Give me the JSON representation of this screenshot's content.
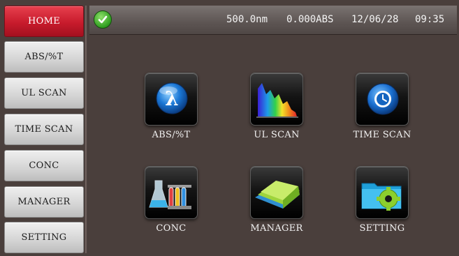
{
  "sidebar": {
    "items": [
      {
        "label": "HOME",
        "active": true
      },
      {
        "label": "ABS/%T",
        "active": false
      },
      {
        "label": "UL SCAN",
        "active": false
      },
      {
        "label": "TIME SCAN",
        "active": false
      },
      {
        "label": "CONC",
        "active": false
      },
      {
        "label": "MANAGER",
        "active": false
      },
      {
        "label": "SETTING",
        "active": false
      }
    ]
  },
  "status": {
    "icon": "check-circle-icon",
    "wavelength": "500.0nm",
    "absorbance": "0.000ABS",
    "date": "12/06/28",
    "time": "09:35"
  },
  "tiles": [
    {
      "label": "ABS/%T",
      "icon": "lambda-icon"
    },
    {
      "label": "UL SCAN",
      "icon": "spectrum-icon"
    },
    {
      "label": "TIME SCAN",
      "icon": "clock-icon"
    },
    {
      "label": "CONC",
      "icon": "flasks-icon"
    },
    {
      "label": "MANAGER",
      "icon": "folders-icon"
    },
    {
      "label": "SETTING",
      "icon": "gear-folder-icon"
    }
  ],
  "colors": {
    "active_nav": "#c81b2c",
    "background": "#4a3f3c",
    "ok_green": "#2e9d1f"
  }
}
